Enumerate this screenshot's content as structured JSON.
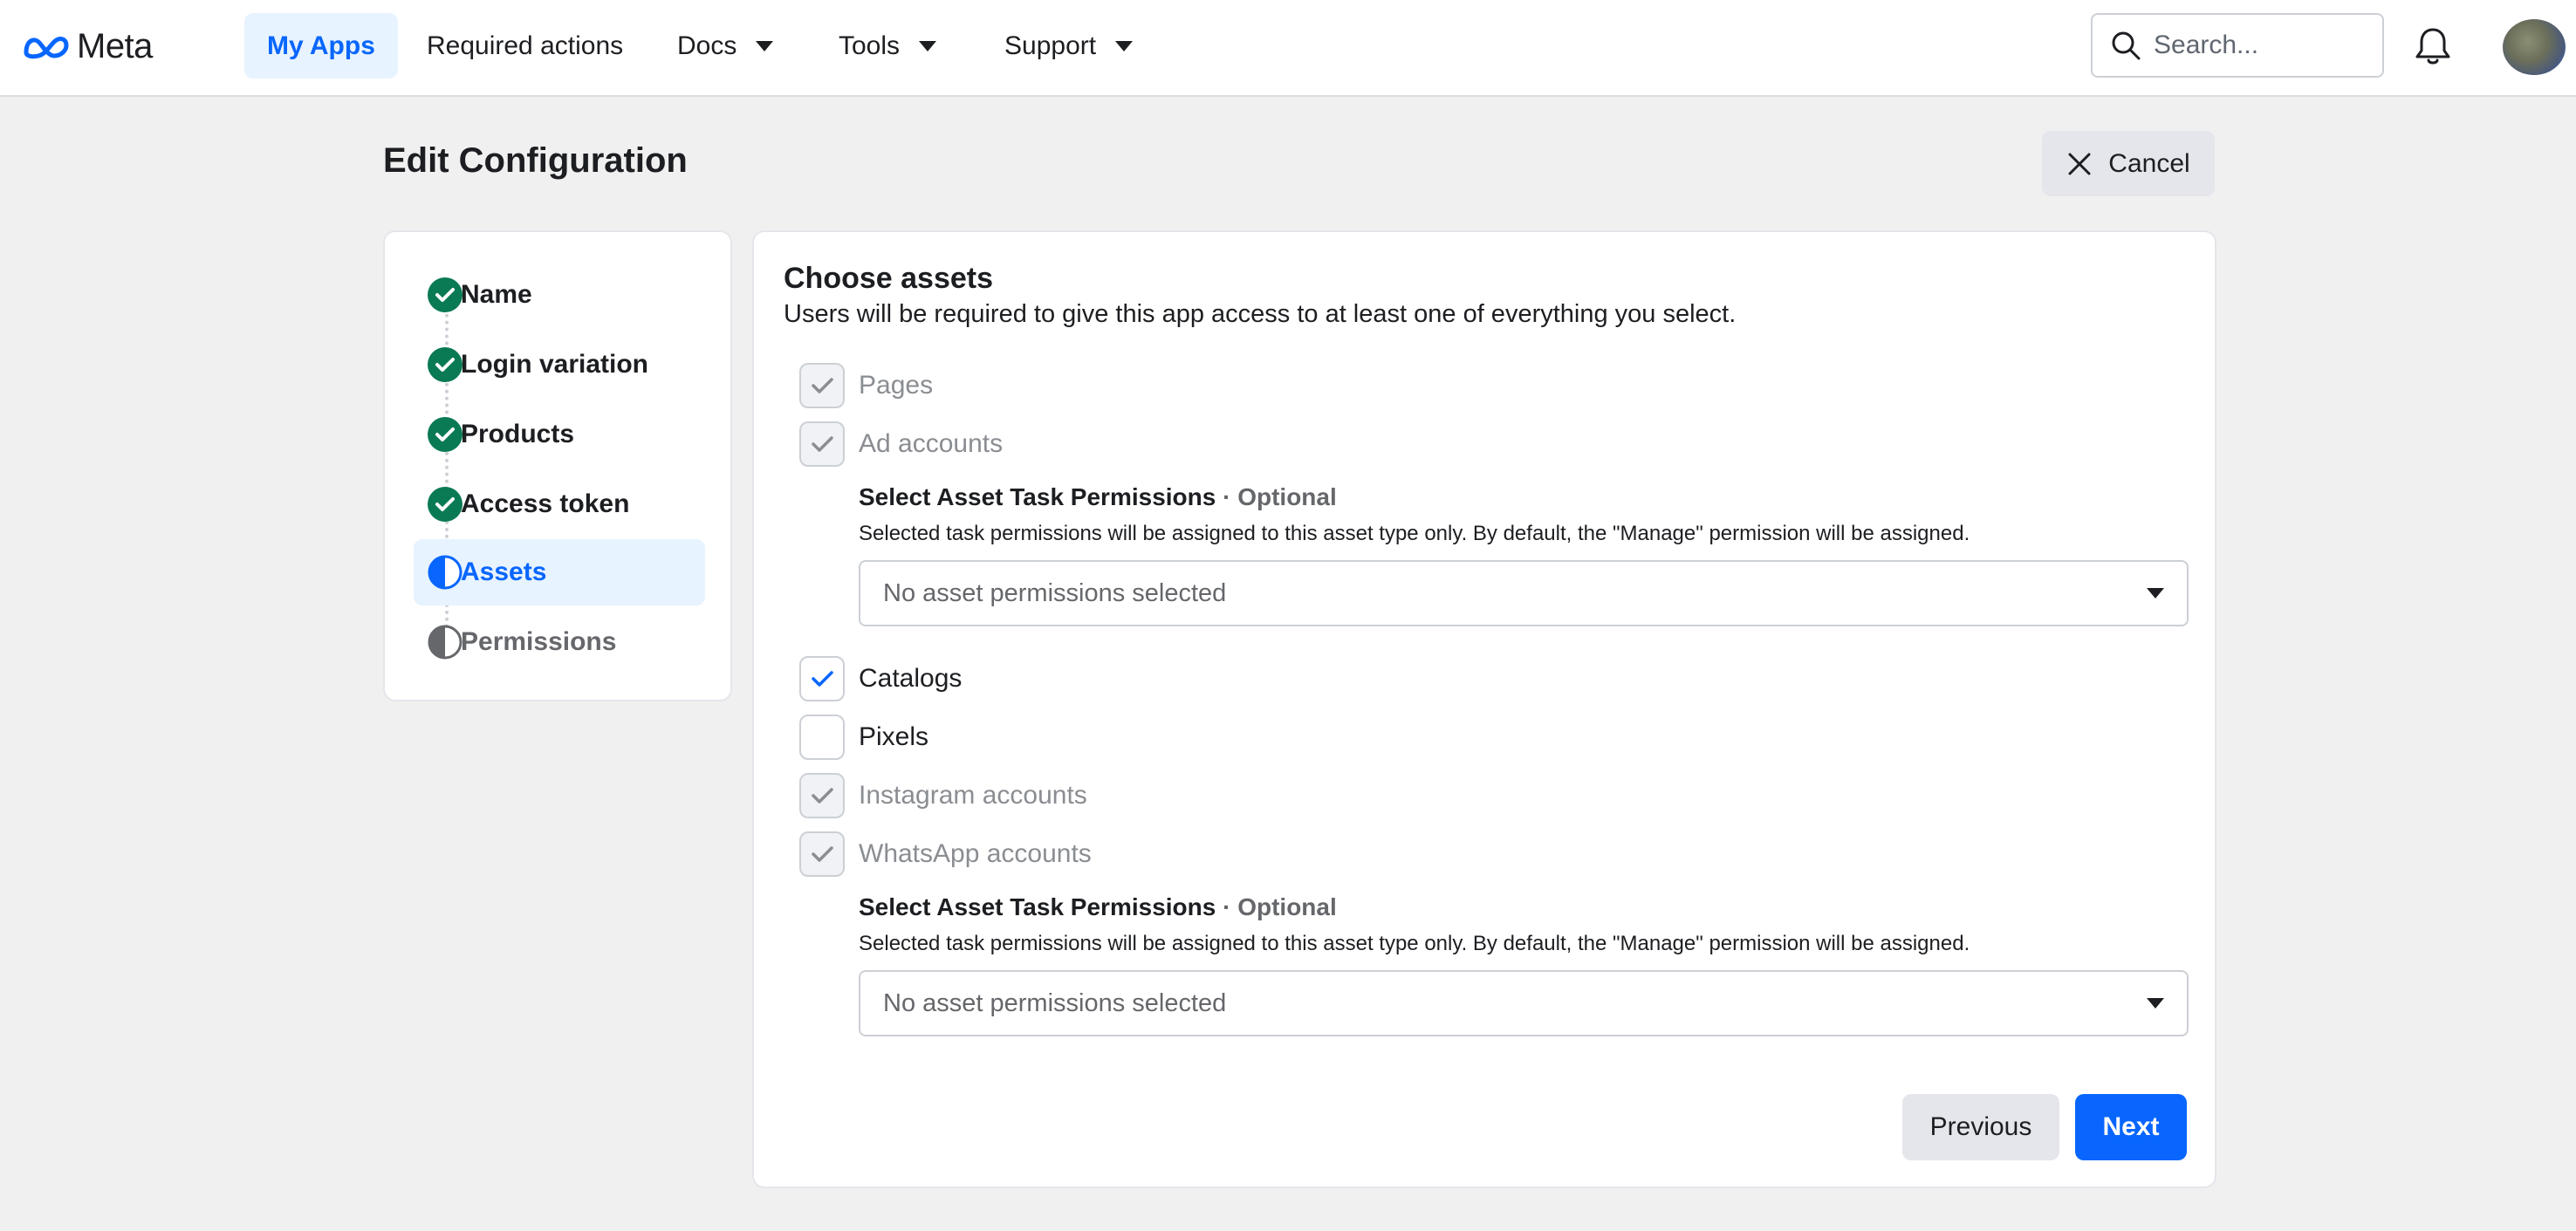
{
  "brand": {
    "name": "Meta",
    "accent": "#0866ff",
    "success": "#0a7a54"
  },
  "nav": {
    "items": [
      {
        "label": "My Apps",
        "active": true,
        "dropdown": false
      },
      {
        "label": "Required actions",
        "active": false,
        "dropdown": false
      },
      {
        "label": "Docs",
        "active": false,
        "dropdown": true
      },
      {
        "label": "Tools",
        "active": false,
        "dropdown": true
      },
      {
        "label": "Support",
        "active": false,
        "dropdown": true
      }
    ],
    "search_placeholder": "Search...",
    "bell_icon": "bell-icon",
    "avatar_icon": "user-avatar"
  },
  "page": {
    "title": "Edit Configuration",
    "cancel_label": "Cancel"
  },
  "steps": [
    {
      "label": "Name",
      "status": "complete"
    },
    {
      "label": "Login variation",
      "status": "complete"
    },
    {
      "label": "Products",
      "status": "complete"
    },
    {
      "label": "Access token",
      "status": "complete"
    },
    {
      "label": "Assets",
      "status": "current"
    },
    {
      "label": "Permissions",
      "status": "pending"
    }
  ],
  "assets_section": {
    "title": "Choose assets",
    "subtitle": "Users will be required to give this app access to at least one of everything you select.",
    "assets": [
      {
        "label": "Pages",
        "checked": true,
        "disabled": true
      },
      {
        "label": "Ad accounts",
        "checked": true,
        "disabled": true
      },
      {
        "label": "Catalogs",
        "checked": true,
        "disabled": false
      },
      {
        "label": "Pixels",
        "checked": false,
        "disabled": false
      },
      {
        "label": "Instagram accounts",
        "checked": true,
        "disabled": true
      },
      {
        "label": "WhatsApp accounts",
        "checked": true,
        "disabled": true
      }
    ],
    "permissions": [
      {
        "title": "Select Asset Task Permissions",
        "optional": "· Optional",
        "description": "Selected task permissions will be assigned to this asset type only. By default, the \"Manage\" permission will be assigned.",
        "dropdown_value": "No asset permissions selected"
      },
      {
        "title": "Select Asset Task Permissions",
        "optional": "· Optional",
        "description": "Selected task permissions will be assigned to this asset type only. By default, the \"Manage\" permission will be assigned.",
        "dropdown_value": "No asset permissions selected"
      }
    ],
    "previous_label": "Previous",
    "next_label": "Next"
  }
}
